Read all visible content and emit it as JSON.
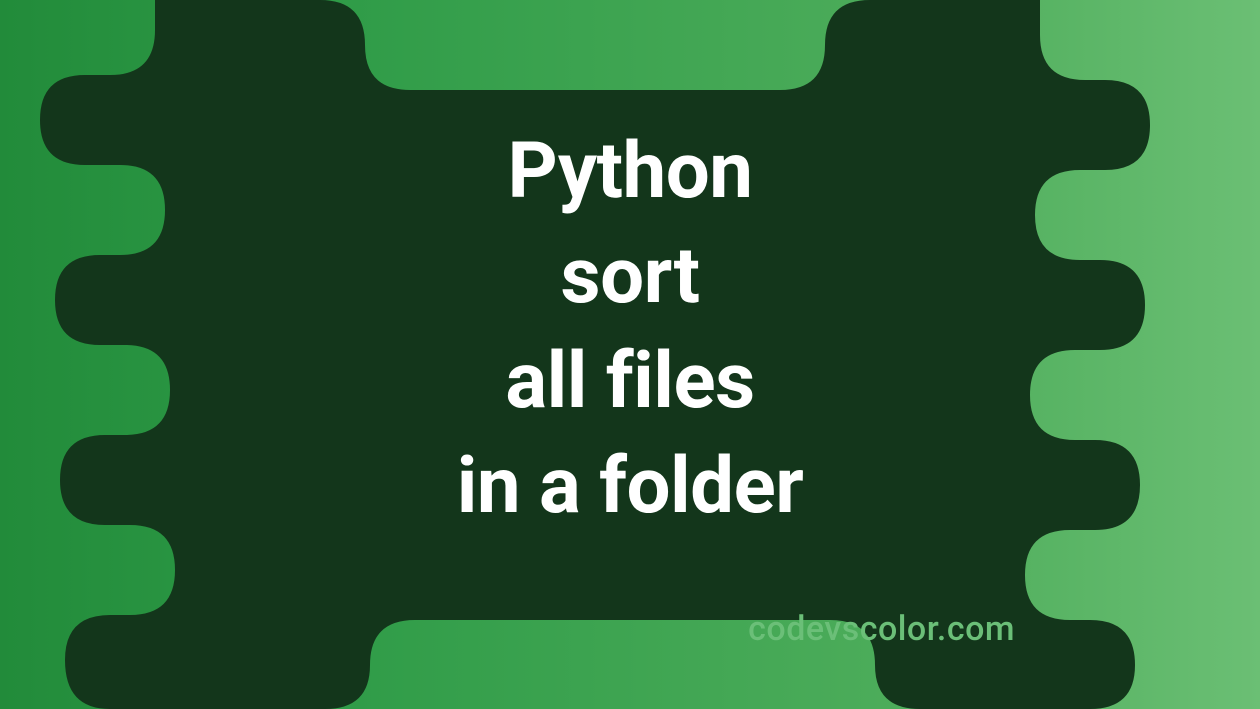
{
  "title_lines": "Python\nsort\nall files\nin a folder",
  "credit": "codevscolor.com",
  "colors": {
    "background_gradient_start": "#228B3A",
    "background_gradient_end": "#6BBF74",
    "blob_fill": "#13361B",
    "title_text": "#FFFFFF",
    "credit_text": "#6BBF78"
  }
}
